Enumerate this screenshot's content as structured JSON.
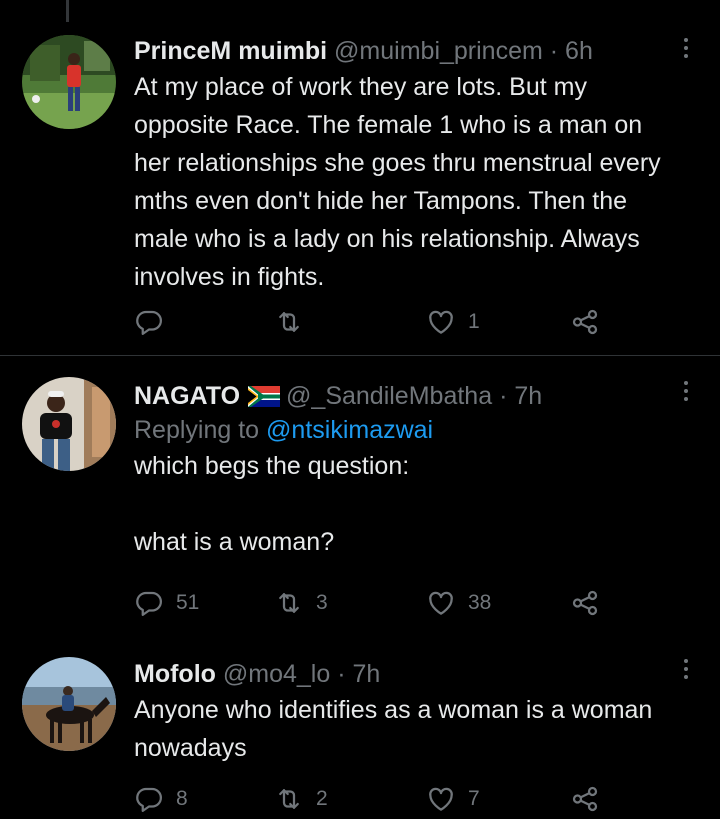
{
  "tweets": [
    {
      "name": "PrinceM muimbi",
      "handle": "@muimbi_princem",
      "time": "6h",
      "text": "At my place of work they are lots. But my opposite Race. The female 1 who is a man on her relationships she goes thru menstrual every mths even don't hide her Tampons. Then the male who is a lady on his relationship. Always involves in fights.",
      "replies": "",
      "retweets": "",
      "likes": "1"
    },
    {
      "name": "NAGATO",
      "handle": "@_SandileMbatha",
      "time": "7h",
      "replying_prefix": "Replying to",
      "replying_to": "@ntsikimazwai",
      "text": "which begs the question:\n\nwhat is a woman?",
      "replies": "51",
      "retweets": "3",
      "likes": "38"
    },
    {
      "name": "Mofolo",
      "handle": "@mo4_lo",
      "time": "7h",
      "text": "Anyone who identifies as a woman is a woman nowadays",
      "replies": "8",
      "retweets": "2",
      "likes": "7"
    }
  ],
  "separator": "·",
  "icons": {
    "reply": "reply-icon",
    "retweet": "retweet-icon",
    "like": "heart-icon",
    "share": "share-icon",
    "more": "more-options-icon",
    "flag": "south-africa-flag-icon"
  },
  "colors": {
    "background": "#000000",
    "text": "#e7e9ea",
    "secondary": "#71767b",
    "link": "#1d9bf0",
    "divider": "#2f3336"
  }
}
